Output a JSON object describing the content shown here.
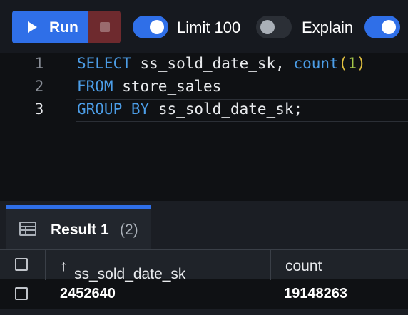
{
  "toolbar": {
    "run_label": "Run",
    "limit_label": "Limit 100",
    "limit_on": true,
    "explain_label": "Explain",
    "explain_on": false,
    "trailing_toggle_on": true
  },
  "editor": {
    "lines": [
      {
        "number": "1",
        "text": "SELECT ss_sold_date_sk, count(1)"
      },
      {
        "number": "2",
        "text": "FROM store_sales"
      },
      {
        "number": "3",
        "text": "GROUP BY ss_sold_date_sk;"
      }
    ]
  },
  "results": {
    "tab_title": "Result 1",
    "tab_count": "(2)",
    "columns": [
      "ss_sold_date_sk",
      "count"
    ],
    "sort_indicator": "↑",
    "rows": [
      [
        "2452640",
        "19148263"
      ]
    ]
  },
  "icons": {
    "run": "play-icon",
    "stop": "stop-icon",
    "table": "table-icon",
    "sort": "sort-ascending-icon"
  },
  "colors": {
    "accent": "#2f6fe8",
    "keyword": "#4c9ee8",
    "number": "#a6c84a",
    "paren": "#e0c040"
  }
}
